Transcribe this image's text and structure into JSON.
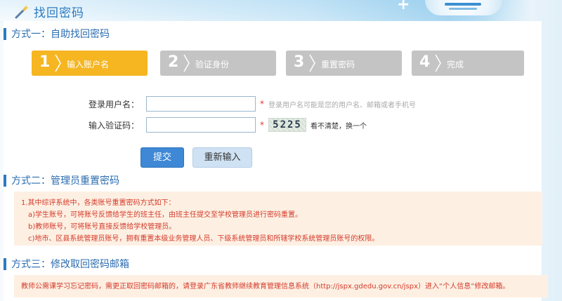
{
  "header": {
    "title": "找回密码"
  },
  "method1": {
    "title": "方式一：自助找回密码",
    "steps": [
      {
        "num": "1",
        "label": "输入账户名",
        "active": true
      },
      {
        "num": "2",
        "label": "验证身份",
        "active": false
      },
      {
        "num": "3",
        "label": "重置密码",
        "active": false
      },
      {
        "num": "4",
        "label": "完成",
        "active": false
      }
    ],
    "form": {
      "username_label": "登录用户名：",
      "username_value": "",
      "username_hint": "登录用户名可能是您的用户名、邮箱或者手机号",
      "captcha_label": "输入验证码：",
      "captcha_value": "",
      "captcha_text": "5225",
      "captcha_refresh": "看不清楚，换一个",
      "required_mark": "*",
      "submit_label": "提交",
      "reset_label": "重新输入"
    }
  },
  "method2": {
    "title": "方式二：管理员重置密码",
    "lines": [
      "1.其中综评系统中，各类账号重置密码方式如下：",
      "a)学生账号，可将账号反馈给学生的班主任，由班主任提交至学校管理员进行密码重置。",
      "b)教师账号，可将账号直接反馈给学校管理员。",
      "c)地市、区县系统管理员账号，拥有重置本级业务管理人员、下级系统管理员和所辖学校系统管理员账号的权限。"
    ]
  },
  "method3": {
    "title": "方式三：修改取回密码邮箱",
    "text": "教师公需课学习忘记密码，需更正取回密码邮箱的，请登录广东省教师继续教育管理信息系统（http://jspx.gdedu.gov.cn/jspx）进入“个人信息”修改邮箱。"
  },
  "colors": {
    "step_active": "#f5b622",
    "step_inactive": "#c4c4c4",
    "accent_blue": "#2b7bc0",
    "notice_bg": "#fdf0e3",
    "notice_text": "#d43a2a"
  }
}
